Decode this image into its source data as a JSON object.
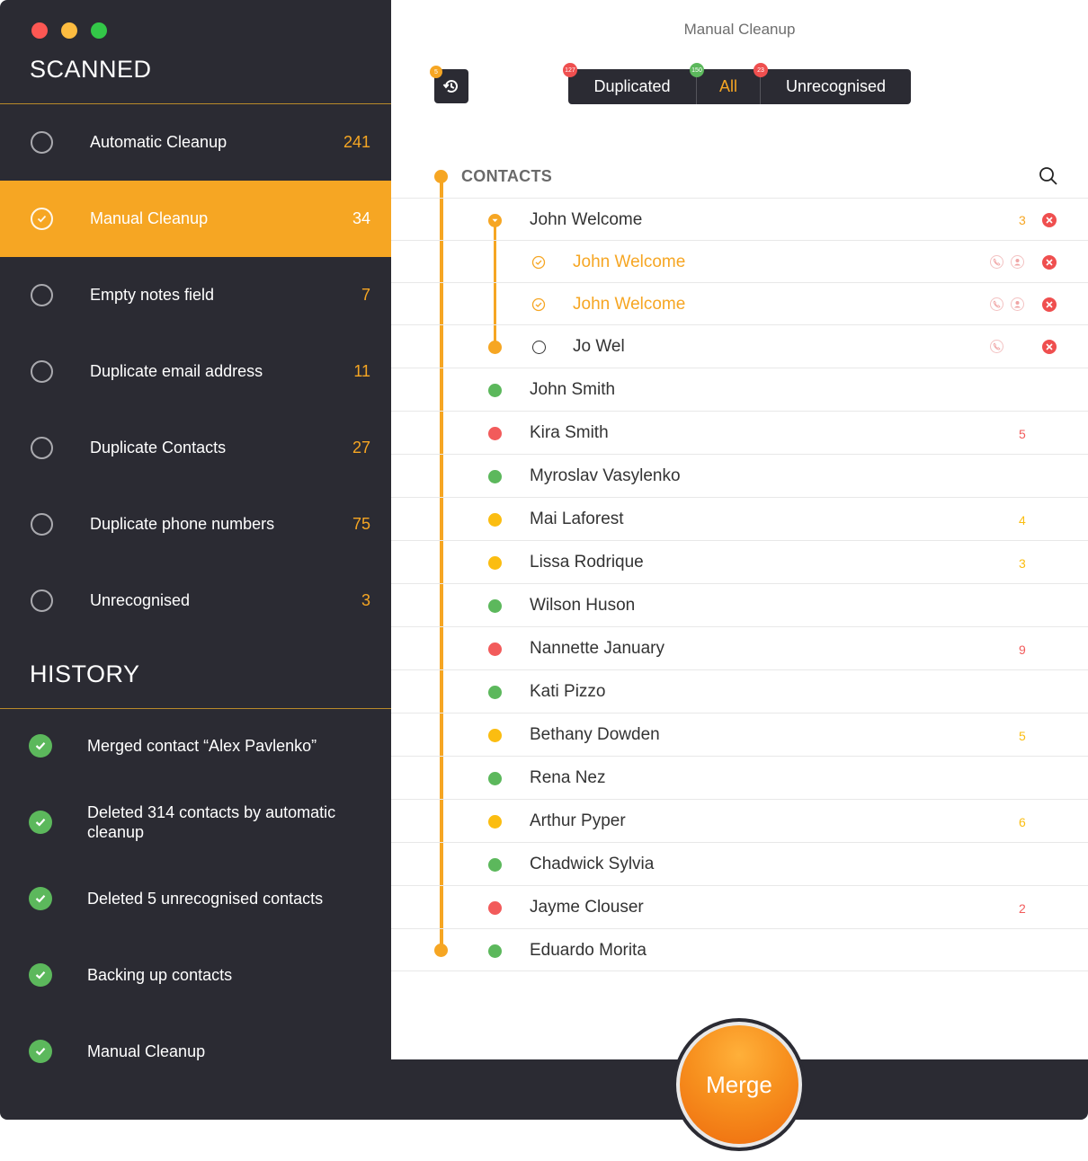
{
  "window": {
    "title": "Manual Cleanup"
  },
  "sidebar": {
    "scanned_title": "SCANNED",
    "history_title": "HISTORY",
    "scan_items": [
      {
        "label": "Automatic Cleanup",
        "count": "241",
        "active": false
      },
      {
        "label": "Manual Cleanup",
        "count": "34",
        "active": true
      },
      {
        "label": "Empty notes field",
        "count": "7",
        "active": false
      },
      {
        "label": "Duplicate email address",
        "count": "11",
        "active": false
      },
      {
        "label": "Duplicate Contacts",
        "count": "27",
        "active": false
      },
      {
        "label": "Duplicate phone numbers",
        "count": "75",
        "active": false
      },
      {
        "label": "Unrecognised",
        "count": "3",
        "active": false
      }
    ],
    "history_items": [
      {
        "label": "Merged contact “Alex Pavlenko”"
      },
      {
        "label": "Deleted 314 contacts by automatic cleanup"
      },
      {
        "label": "Deleted 5 unrecognised contacts"
      },
      {
        "label": "Backing up contacts"
      },
      {
        "label": "Manual Cleanup"
      }
    ]
  },
  "toolbar": {
    "history_badge": "5",
    "filters": [
      {
        "label": "Duplicated",
        "badge": "127",
        "badge_color": "#ef4f4f"
      },
      {
        "label": "All",
        "badge": "150",
        "badge_color": "#5cb85c"
      },
      {
        "label": "Unrecognised",
        "badge": "23",
        "badge_color": "#ef4f4f"
      }
    ]
  },
  "contacts": {
    "header": "CONTACTS",
    "group": {
      "parent": {
        "name": "John Welcome",
        "count": "3"
      },
      "children": [
        {
          "name": "John Welcome",
          "checked": true
        },
        {
          "name": "John Welcome",
          "checked": true
        },
        {
          "name": "Jo Wel",
          "checked": false
        }
      ]
    },
    "rows": [
      {
        "name": "John Smith",
        "status": "green",
        "count": ""
      },
      {
        "name": "Kira Smith",
        "status": "red",
        "count": "5"
      },
      {
        "name": "Myroslav Vasylenko",
        "status": "green",
        "count": ""
      },
      {
        "name": "Mai Laforest",
        "status": "yellow",
        "count": "4"
      },
      {
        "name": "Lissa Rodrique",
        "status": "yellow",
        "count": "3"
      },
      {
        "name": "Wilson Huson",
        "status": "green",
        "count": ""
      },
      {
        "name": "Nannette January",
        "status": "red",
        "count": "9"
      },
      {
        "name": "Kati Pizzo",
        "status": "green",
        "count": ""
      },
      {
        "name": "Bethany Dowden",
        "status": "yellow",
        "count": "5"
      },
      {
        "name": "Rena Nez",
        "status": "green",
        "count": ""
      },
      {
        "name": "Arthur Pyper",
        "status": "yellow",
        "count": "6"
      },
      {
        "name": "Chadwick Sylvia",
        "status": "green",
        "count": ""
      },
      {
        "name": "Jayme Clouser",
        "status": "red",
        "count": "2"
      },
      {
        "name": "Eduardo Morita",
        "status": "green",
        "count": ""
      }
    ]
  },
  "colors": {
    "accent": "#f6a623",
    "green": "#5cb85c",
    "red": "#f25b5b",
    "yellow": "#fbbd11",
    "sidebar_bg": "#2b2b33"
  },
  "merge": {
    "label": "Merge"
  }
}
